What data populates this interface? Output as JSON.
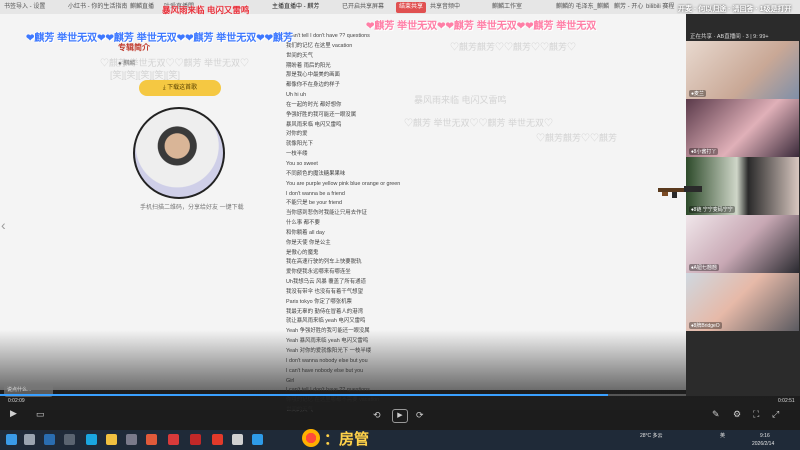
{
  "browser": {
    "tabs": [
      {
        "label": "书签导入 - 设置",
        "x_hint": "left"
      },
      {
        "label": "小红书 - 你的生活指南"
      },
      {
        "label": "麒麟直播"
      },
      {
        "label": "叶爱直播間"
      },
      {
        "label": "主播直播中 - 麒芳"
      },
      {
        "label": "已开启共享屏幕"
      },
      {
        "label": "结束共享",
        "badge": true
      },
      {
        "label": "共享音频中"
      },
      {
        "label": "麒麟工作室"
      },
      {
        "label": "麒麟的 毛泽东_麒麟"
      },
      {
        "label": "麒芳 - 开心"
      },
      {
        "label": "bilibili 赛程"
      }
    ],
    "accent": "#e05050"
  },
  "page": {
    "title": "专辑简介",
    "subtitle": "● 麒麟",
    "download_button": "下载这首歌",
    "avatar_caption": "手机扫描二维码，分享给好友 一键下载",
    "lyrics": [
      "I can't tell I don't have ?? questions",
      "我们的记忆 在这里 vacation",
      "世间的天气",
      "期盼着 雨后的阳光",
      "那是我心中最美的画面",
      "都像你不在身边的样子",
      "Uh hi uh",
      "在一起的时光 都好想你",
      "争强好胜的我可能还一眼没属",
      "暴风雨来临 电闪又雷鸣",
      "对你的爱",
      "就像阳光下",
      "一枝半缕",
      "You so sweet",
      "不同颜色的魔法糖果果味",
      "You are purple yellow pink blue orange or green",
      "I don't wanna be a friend",
      "不能只是 be your friend",
      "当你感到悲伤时我能让只用去作证",
      "什么事 都不要",
      "和你躺着 all day",
      "你是天使 你是公主",
      "是傲心的魔鬼",
      "我在高速行驶的列车上快要脱轨",
      "爱你便我永远哪来有哪连坐",
      "Uh我想乌云 风暴 覆盖了所有通道",
      "我没有带伞 也没有有着干气想望",
      "Paris tokyo 你定了哪张机票",
      "我最无辜的 勤侍在冒着人的港湾",
      "就让暴风雨来临 yeah 电闪又雷鸣",
      "Yeah 争强好胜的我可能还一眼没属",
      "Yeah 暴风雨来临 yeah 电闪又雷鸣",
      "Yeah 对你的爱就像阳光下 一枝半缕",
      "I don't wanna nobody else but you",
      "I can't have nobody else but you",
      "Girl",
      "I can't tell I don't have ?? questions",
      "你哦的记忆 在这里哪都不需要 vacation",
      "世间的天气"
    ]
  },
  "player": {
    "comment_placeholder": "说点什么...",
    "current_time": "0:02:09",
    "total_time": "0:02:51",
    "progress_fraction": 0.76,
    "accent": "#3aa0ff"
  },
  "voice_panel": {
    "header": "正在共享 · AB直播间 · 3 | 9: 99+",
    "participants": [
      {
        "name": "●麦兰"
      },
      {
        "name": "♦8小酱打丫"
      },
      {
        "name": "♦8链 宁宁变码宁宁"
      },
      {
        "name": "♦A钮七翘翘"
      },
      {
        "name": "♦8牌BridgeO"
      }
    ]
  },
  "danmaku": [
    {
      "text": "暴风雨来临 电闪又雷鸣",
      "style": "red"
    },
    {
      "text": "❤麒芳 举世无双❤❤麒芳 举世无双❤❤麒芳 举世无双",
      "style": "pink"
    },
    {
      "text": "❤麒芳 举世无双❤❤麒芳 举世无双❤❤麒芳 举世无双❤❤麒芳",
      "style": "blue"
    },
    {
      "text": "♡麒芳 举世无双♡♡麒芳 举世无双♡",
      "style": "faint"
    },
    {
      "text": "♡麒芳麒芳♡♡麒芳♡♡麒芳♡",
      "style": "faint"
    },
    {
      "text": "暴风雨来临 电闪又雷鸣",
      "style": "faint"
    },
    {
      "text": "开麦 · 何以归途 · 请回答 · 1级是打开",
      "style": "topright"
    },
    {
      "text": "[笑][笑][笑][笑][笑]",
      "style": "faint"
    },
    {
      "text": "♡麒芳 举世无双♡♡麒芳 举世无双♡",
      "style": "faint"
    },
    {
      "text": "♡麒芳麒芳♡♡麒芳",
      "style": "faint"
    }
  ],
  "banner": {
    "text": "：房管",
    "color": "#ffd34a"
  },
  "taskbar": {
    "weather": "28°C 多云",
    "ime": "英",
    "time": "9:16",
    "date": "2026/2/14"
  }
}
